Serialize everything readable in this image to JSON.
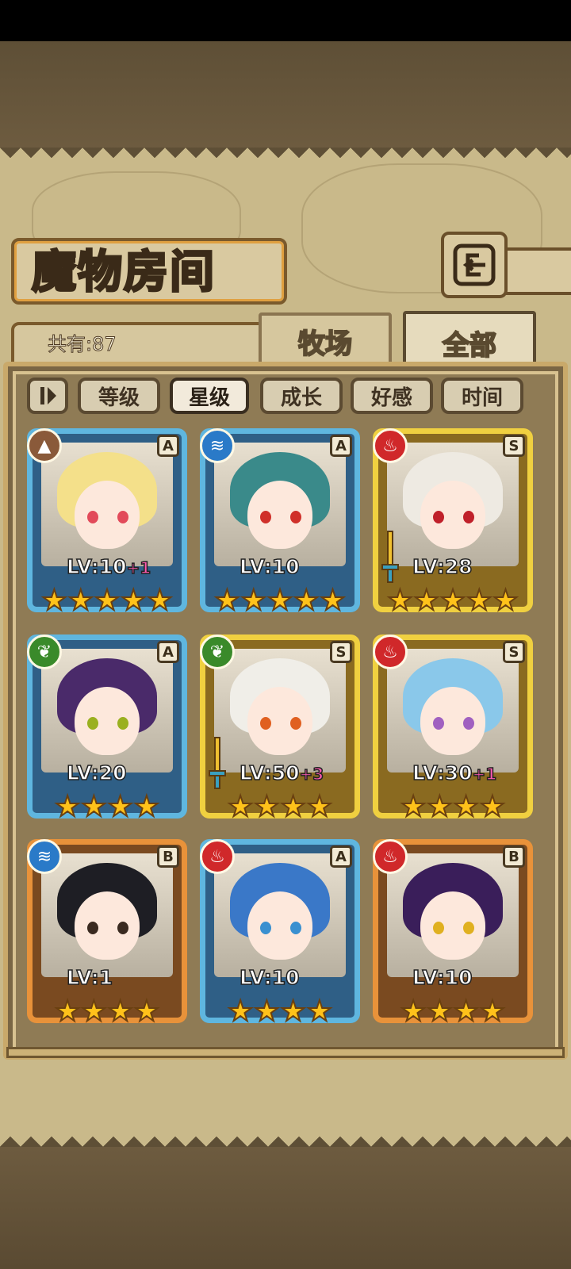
{
  "page": {
    "title": "魔物房间",
    "count_label": "共有:87"
  },
  "tabs": {
    "ranch": "牧场",
    "all": "全部"
  },
  "sort": {
    "toggle_icon": "sort-order-toggle-icon",
    "buttons": [
      {
        "label": "等级",
        "active": false
      },
      {
        "label": "星级",
        "active": true
      },
      {
        "label": "成长",
        "active": false
      },
      {
        "label": "好感",
        "active": false
      },
      {
        "label": "时间",
        "active": false
      }
    ]
  },
  "monsters": [
    {
      "level": "LV:10",
      "bonus": "+1",
      "rank": "A",
      "element": "earth",
      "stars": 5,
      "frame": "blue",
      "hair": "#f4e08a",
      "eye": "#e24a5a"
    },
    {
      "level": "LV:10",
      "bonus": "",
      "rank": "A",
      "element": "water",
      "stars": 5,
      "frame": "blue",
      "hair": "#3a8a8a",
      "eye": "#d0302a"
    },
    {
      "level": "LV:28",
      "bonus": "",
      "rank": "S",
      "element": "fire",
      "stars": 5,
      "frame": "gold",
      "hair": "#eeeae2",
      "eye": "#c0202a"
    },
    {
      "level": "LV:20",
      "bonus": "",
      "rank": "A",
      "element": "wind",
      "stars": 4,
      "frame": "blue",
      "hair": "#4a2a6a",
      "eye": "#9ab020"
    },
    {
      "level": "LV:50",
      "bonus": "+3",
      "rank": "S",
      "element": "wind",
      "stars": 4,
      "frame": "gold",
      "hair": "#f0eee8",
      "eye": "#e06020"
    },
    {
      "level": "LV:30",
      "bonus": "+1",
      "rank": "S",
      "element": "fire",
      "stars": 4,
      "frame": "gold",
      "hair": "#8ac8ea",
      "eye": "#a060c0"
    },
    {
      "level": "LV:1",
      "bonus": "",
      "rank": "B",
      "element": "water",
      "stars": 4,
      "frame": "orange",
      "hair": "#1e1e24",
      "eye": "#3a2a20"
    },
    {
      "level": "LV:10",
      "bonus": "",
      "rank": "A",
      "element": "fire",
      "stars": 4,
      "frame": "blue",
      "hair": "#3a78c8",
      "eye": "#3a90d0"
    },
    {
      "level": "LV:10",
      "bonus": "",
      "rank": "B",
      "element": "fire",
      "stars": 4,
      "frame": "orange",
      "hair": "#3a1e5a",
      "eye": "#e0b020"
    }
  ],
  "element_colors": {
    "earth": "#8a5a3a",
    "water": "#2a7ac8",
    "fire": "#d0282a",
    "wind": "#3a8a2a"
  },
  "icons": {
    "back": "back-arrow-icon",
    "star": "★"
  }
}
